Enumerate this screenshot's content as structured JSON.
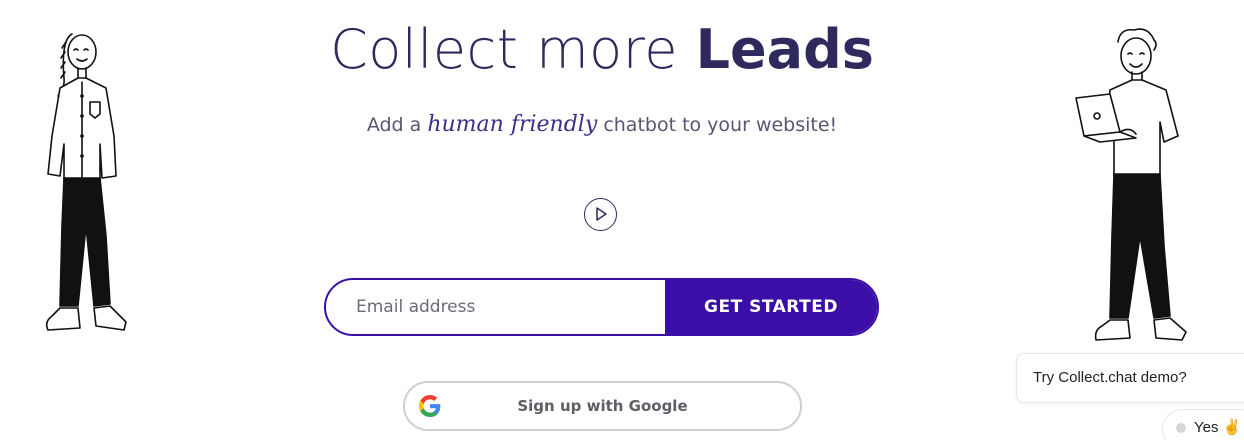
{
  "hero": {
    "title_light": "Collect more",
    "title_bold": "Leads",
    "subtitle_before": "Add a",
    "subtitle_script": "human friendly",
    "subtitle_after": "chatbot to your website!"
  },
  "video": {
    "icon": "play-circle-icon"
  },
  "signup": {
    "email_placeholder": "Email address",
    "email_value": "",
    "cta_label": "GET STARTED",
    "google_label": "Sign up with Google",
    "google_icon": "google-g-icon"
  },
  "chat_widget": {
    "question": "Try Collect.chat demo?",
    "option_yes": "Yes",
    "option_emoji": "✌"
  },
  "colors": {
    "brand": "#3b0fa7",
    "title": "#2f2a5e",
    "script": "#3b2f8a"
  }
}
